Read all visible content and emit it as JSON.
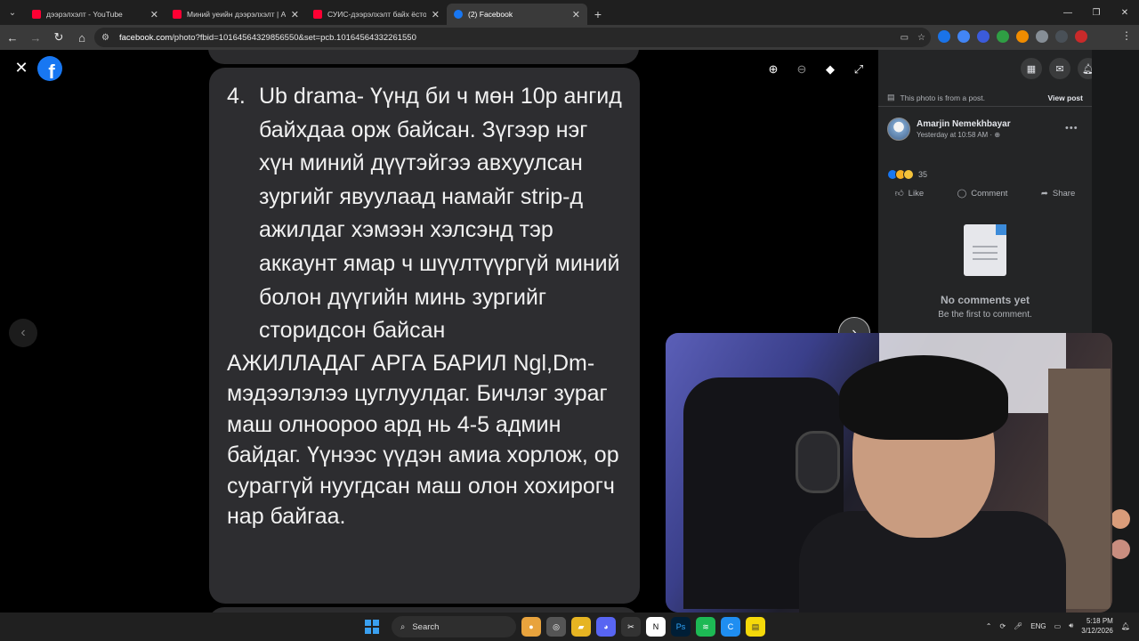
{
  "browser": {
    "tabs": [
      {
        "title": "дээрэлхэлт - YouTube",
        "icon": "youtube-icon",
        "active": false
      },
      {
        "title": "Миний уеийн дээрэлхэлт | АРГ",
        "icon": "youtube-icon",
        "active": false
      },
      {
        "title": "СУИС-дээрэлхэлт байх ёстой",
        "icon": "youtube-icon",
        "active": false
      },
      {
        "title": "(2) Facebook",
        "icon": "facebook-icon",
        "active": true
      }
    ],
    "url_host": "facebook.com",
    "url_path": "/photo?fbid=10164564329856550&set=pcb.10164564332261550"
  },
  "viewer": {
    "logo_letter": "f",
    "message": {
      "item_number": "4.",
      "item_text": "Ub drama- Үүнд би ч мөн 10р ангид байхдаа орж байсан. Зүгээр нэг хүн миний дүүтэйгээ авхуулсан зургийг явуулаад намайг strip-д ажилдаг хэмээн хэлсэнд тэр аккаунт ямар ч шүүлтүүргүй миний болон дүүгийн минь зургийг сторидсон байсан",
      "paragraph": "АЖИЛЛАДАГ АРГА БАРИЛ Ngl,Dm-мэдээлэлээ цуглуулдаг. Бичлэг зураг маш олноороо ард нь 4-5 админ байдаг. Үүнээс үүдэн амиа хорлож, ор сураггүй нуугдсан маш олон хохирогч нар байгаа."
    }
  },
  "sidebar": {
    "notification_count": "2",
    "from_post_text": "This photo is from a post.",
    "view_post_label": "View post",
    "author_name": "Amarjin Nemekhbayar",
    "post_time": "Yesterday at 10:58 AM · ⊕",
    "reaction_count": "35",
    "actions": {
      "like": "Like",
      "comment": "Comment",
      "share": "Share"
    },
    "no_comments_title": "No comments yet",
    "no_comments_sub": "Be the first to comment."
  },
  "taskbar": {
    "search_label": "Search",
    "lang": "ENG",
    "time": "5:18 PM",
    "date": "3/12/2026"
  },
  "colors": {
    "facebook_blue": "#1877f2",
    "bubble_bg": "#2d2d30",
    "sidebar_bg": "#242526",
    "notification_red": "#e41e3f"
  }
}
